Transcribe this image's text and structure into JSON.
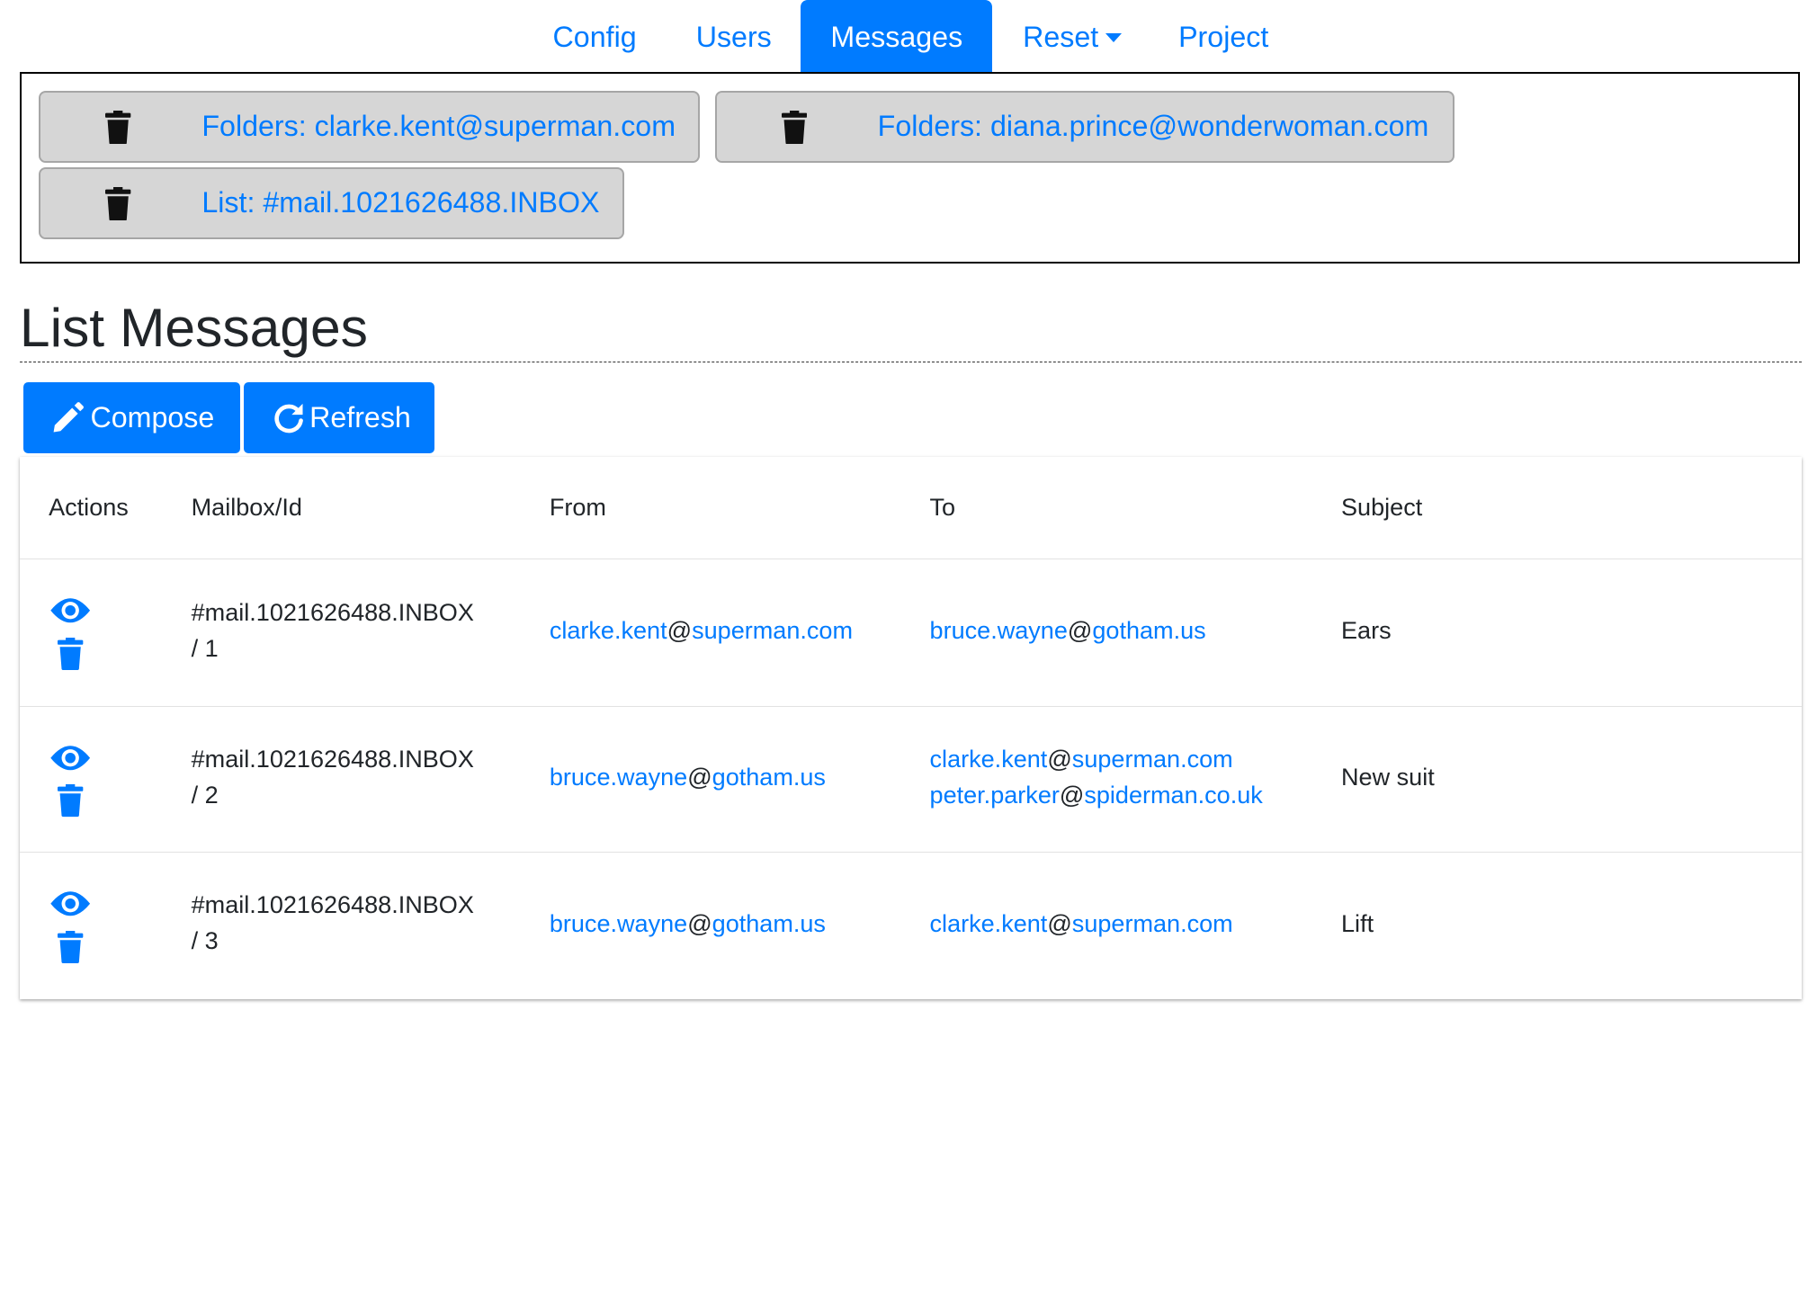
{
  "nav": {
    "items": [
      "Config",
      "Users",
      "Messages",
      "Reset",
      "Project"
    ],
    "active": "Messages"
  },
  "history": {
    "items": [
      "Folders: clarke.kent@superman.com",
      "Folders: diana.prince@wonderwoman.com",
      "List: #mail.1021626488.INBOX"
    ]
  },
  "page": {
    "title": "List Messages"
  },
  "toolbar": {
    "compose_label": "Compose",
    "refresh_label": "Refresh"
  },
  "table": {
    "columns": [
      "Actions",
      "Mailbox/Id",
      "From",
      "To",
      "Subject"
    ],
    "rows": [
      {
        "mailbox": "#mail.1021626488.INBOX",
        "id": "/ 1",
        "from": {
          "user": "clarke.kent",
          "domain": "superman.com"
        },
        "to": [
          {
            "user": "bruce.wayne",
            "domain": "gotham.us"
          }
        ],
        "subject": "Ears"
      },
      {
        "mailbox": "#mail.1021626488.INBOX",
        "id": "/ 2",
        "from": {
          "user": "bruce.wayne",
          "domain": "gotham.us"
        },
        "to": [
          {
            "user": "clarke.kent",
            "domain": "superman.com"
          },
          {
            "user": "peter.parker",
            "domain": "spiderman.co.uk"
          }
        ],
        "subject": "New suit"
      },
      {
        "mailbox": "#mail.1021626488.INBOX",
        "id": "/ 3",
        "from": {
          "user": "bruce.wayne",
          "domain": "gotham.us"
        },
        "to": [
          {
            "user": "clarke.kent",
            "domain": "superman.com"
          }
        ],
        "subject": "Lift"
      }
    ]
  },
  "at_sign": "@",
  "colors": {
    "primary": "#007bff",
    "history_bg": "#d6d6d6"
  },
  "icons": {
    "view": "eye-icon",
    "delete": "trash-icon",
    "compose": "pencil-icon",
    "refresh": "refresh-icon"
  }
}
